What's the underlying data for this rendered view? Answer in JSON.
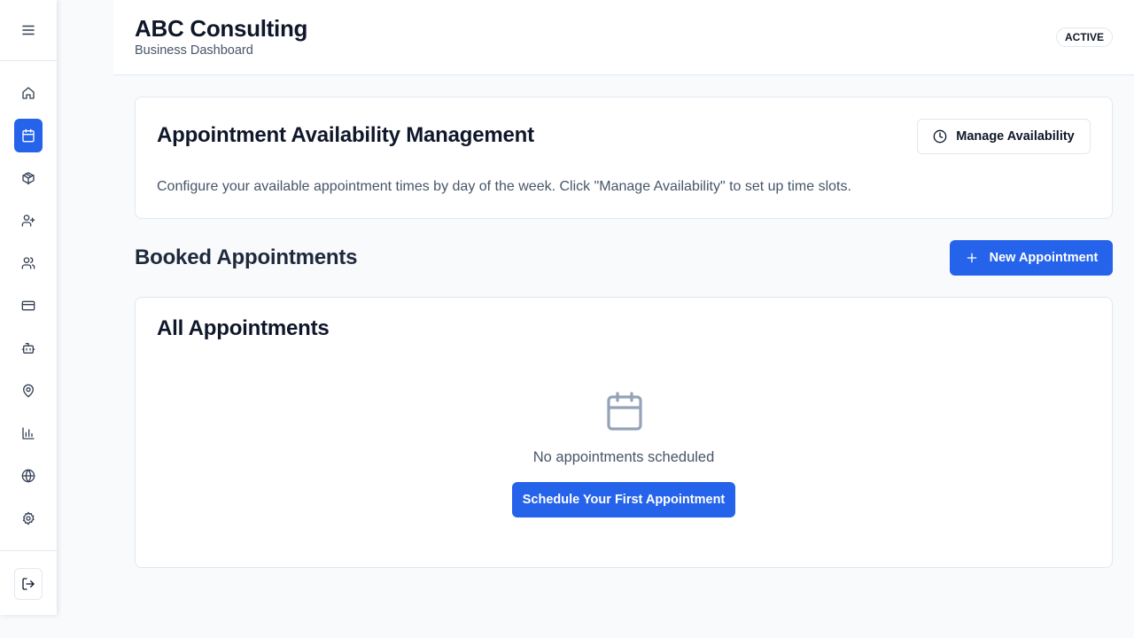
{
  "header": {
    "company": "ABC Consulting",
    "subtitle": "Business Dashboard",
    "status": "ACTIVE"
  },
  "sidebar": {
    "menu_icon": "hamburger-icon",
    "items": [
      {
        "name": "home",
        "icon": "home-icon",
        "active": false
      },
      {
        "name": "appointments",
        "icon": "calendar-icon",
        "active": true
      },
      {
        "name": "products",
        "icon": "package-icon",
        "active": false
      },
      {
        "name": "add-user",
        "icon": "user-plus-icon",
        "active": false
      },
      {
        "name": "users",
        "icon": "users-icon",
        "active": false
      },
      {
        "name": "payments",
        "icon": "credit-card-icon",
        "active": false
      },
      {
        "name": "bot",
        "icon": "bot-icon",
        "active": false
      },
      {
        "name": "locations",
        "icon": "map-pin-icon",
        "active": false
      },
      {
        "name": "analytics",
        "icon": "bar-chart-icon",
        "active": false
      },
      {
        "name": "website",
        "icon": "globe-icon",
        "active": false
      },
      {
        "name": "settings",
        "icon": "gear-icon",
        "active": false
      }
    ],
    "logout_icon": "logout-icon"
  },
  "availability": {
    "title": "Appointment Availability Management",
    "button_label": "Manage Availability",
    "description": "Configure your available appointment times by day of the week. Click \"Manage Availability\" to set up time slots."
  },
  "booked": {
    "title": "Booked Appointments",
    "new_button_label": "New Appointment"
  },
  "list": {
    "title": "All Appointments",
    "empty_text": "No appointments scheduled",
    "cta_label": "Schedule Your First Appointment"
  },
  "colors": {
    "primary": "#2563eb",
    "border": "#e2e8f0",
    "muted_text": "#475569",
    "background": "#f8fafc"
  }
}
